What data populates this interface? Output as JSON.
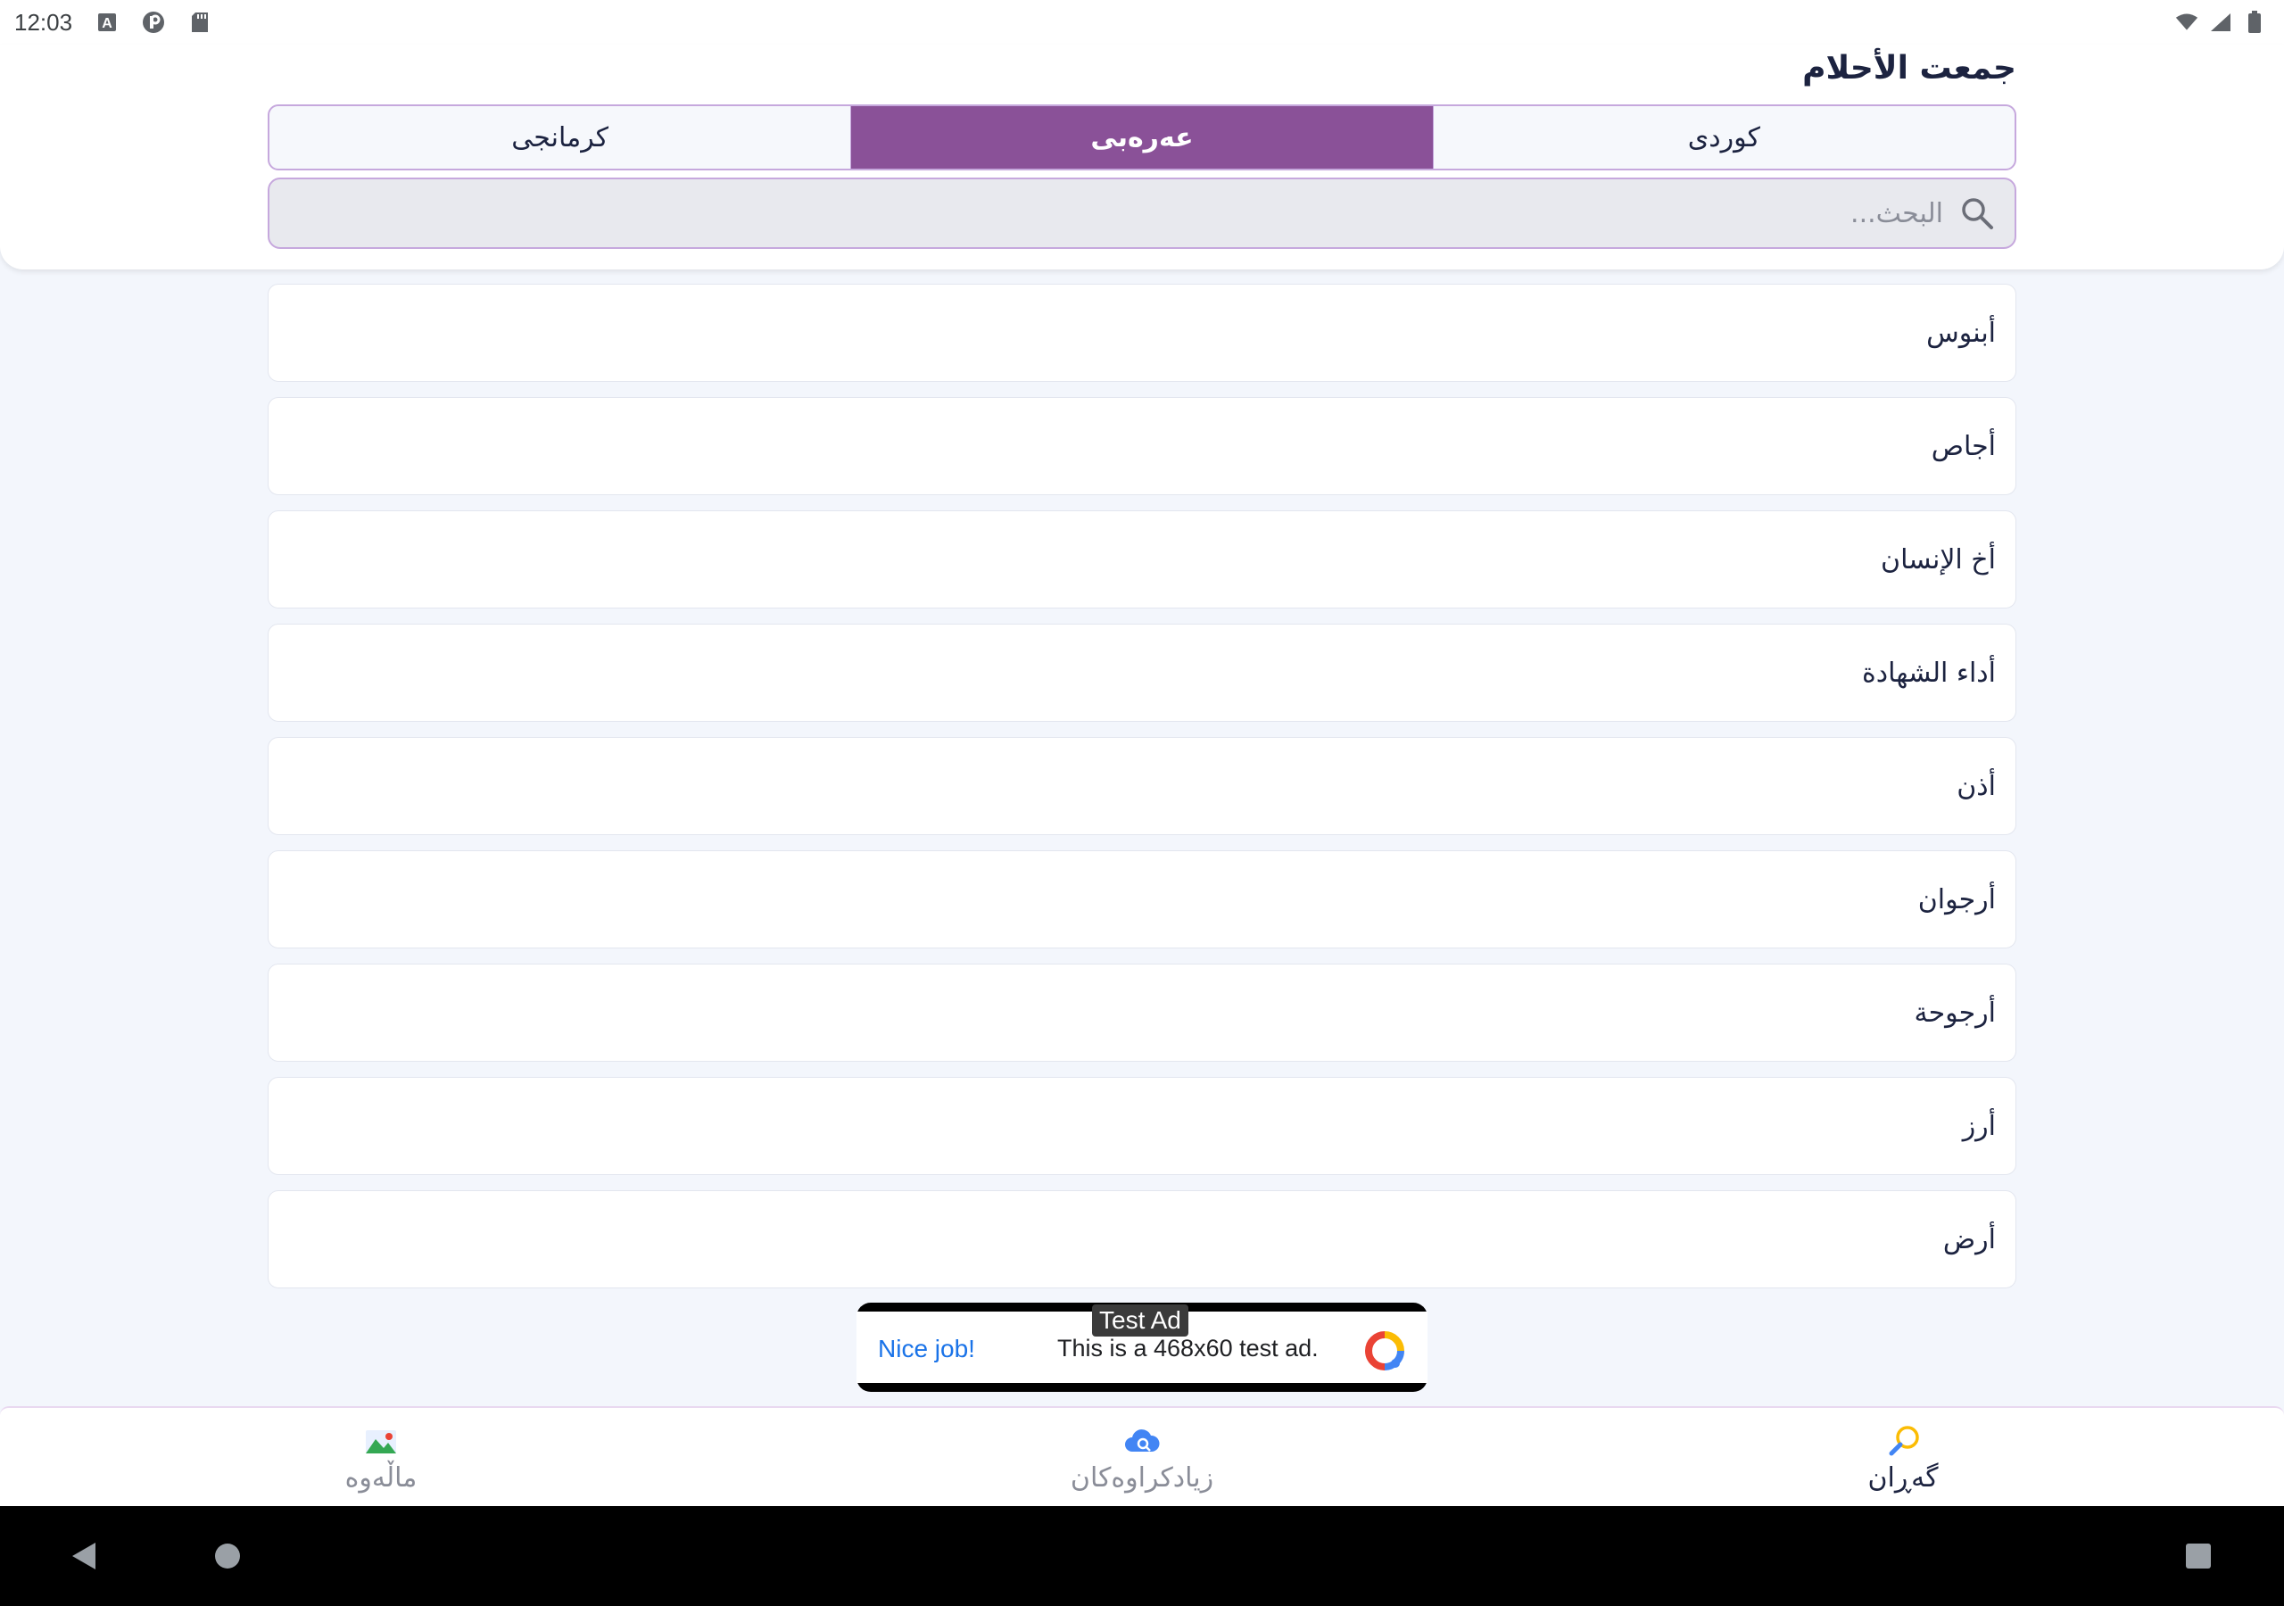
{
  "status_bar": {
    "time": "12:03",
    "icons_left": [
      "keyboard-a-icon",
      "p-badge-icon",
      "sd-card-icon"
    ],
    "icons_right": [
      "wifi-icon",
      "signal-icon",
      "battery-icon"
    ]
  },
  "header": {
    "title": "جمعت الأحلام"
  },
  "tabs": [
    {
      "label": "كرمانجی",
      "active": false
    },
    {
      "label": "عەرەبی",
      "active": true
    },
    {
      "label": "کوردی",
      "active": false
    }
  ],
  "search": {
    "placeholder": "البحث...",
    "value": ""
  },
  "list": {
    "items": [
      "أبنوس",
      "أجاص",
      "أخ الإنسان",
      "أداء الشهادة",
      "أذن",
      "أرجوان",
      "أرجوحة",
      "أرز",
      "أرض"
    ]
  },
  "ad": {
    "label": "Test Ad",
    "nice": "Nice job!",
    "text": "This is a 468x60 test ad."
  },
  "bottom_nav": [
    {
      "label": "ماڵەوە",
      "icon": "image-icon",
      "active": false
    },
    {
      "label": "زیادکراوەکان",
      "icon": "cloud-search-icon",
      "active": false
    },
    {
      "label": "گەڕان",
      "icon": "magnifier-icon",
      "active": true
    }
  ],
  "colors": {
    "accent": "#8a5198",
    "border": "#c6a8dd",
    "background": "#f3f6fc",
    "text": "#1c2340"
  }
}
